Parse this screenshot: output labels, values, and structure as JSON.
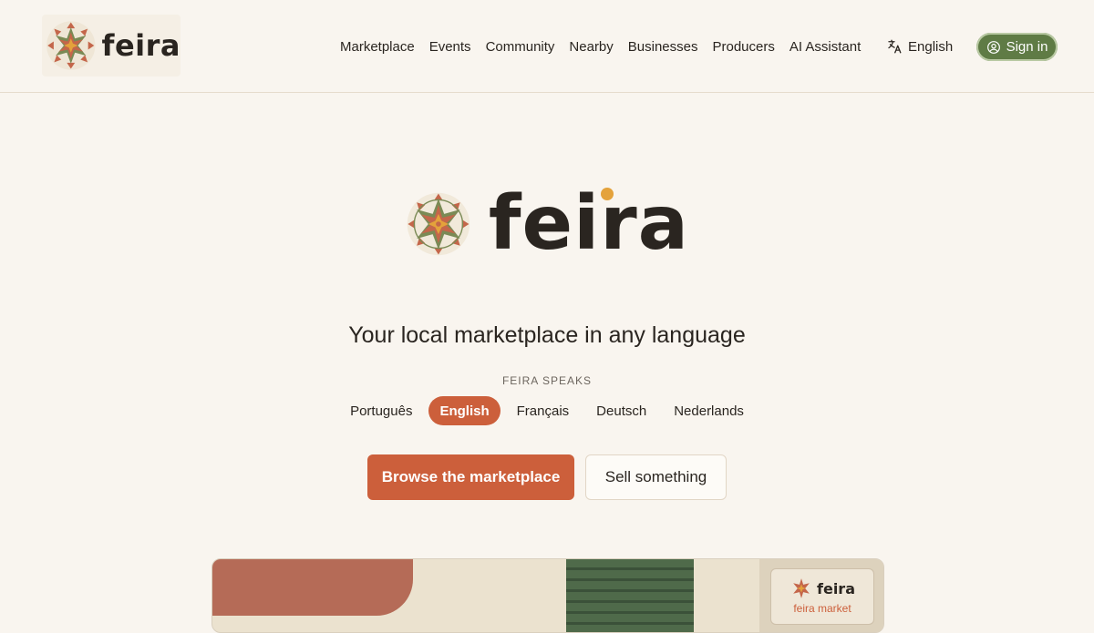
{
  "brand": {
    "name": "feira"
  },
  "nav": {
    "items": [
      "Marketplace",
      "Events",
      "Community",
      "Nearby",
      "Businesses",
      "Producers",
      "AI Assistant"
    ]
  },
  "language_switch": {
    "label": "English",
    "icon": "translate-icon"
  },
  "sign_in": {
    "label": "Sign in",
    "icon": "user-circle-icon"
  },
  "hero": {
    "wordmark": "feira",
    "tagline": "Your local marketplace in any language",
    "speaks_label": "FEIRA SPEAKS",
    "languages": [
      "Português",
      "English",
      "Français",
      "Deutsch",
      "Nederlands"
    ],
    "active_language": "English",
    "primary_cta": "Browse the marketplace",
    "secondary_cta": "Sell something"
  },
  "preview": {
    "sign_title": "feira",
    "sign_subtitle": "feira market"
  },
  "colors": {
    "background": "#f9f5ef",
    "accent": "#cc5f3b",
    "signin_green": "#5f7b45",
    "mustard": "#e4a23b",
    "text": "#2a2520"
  }
}
